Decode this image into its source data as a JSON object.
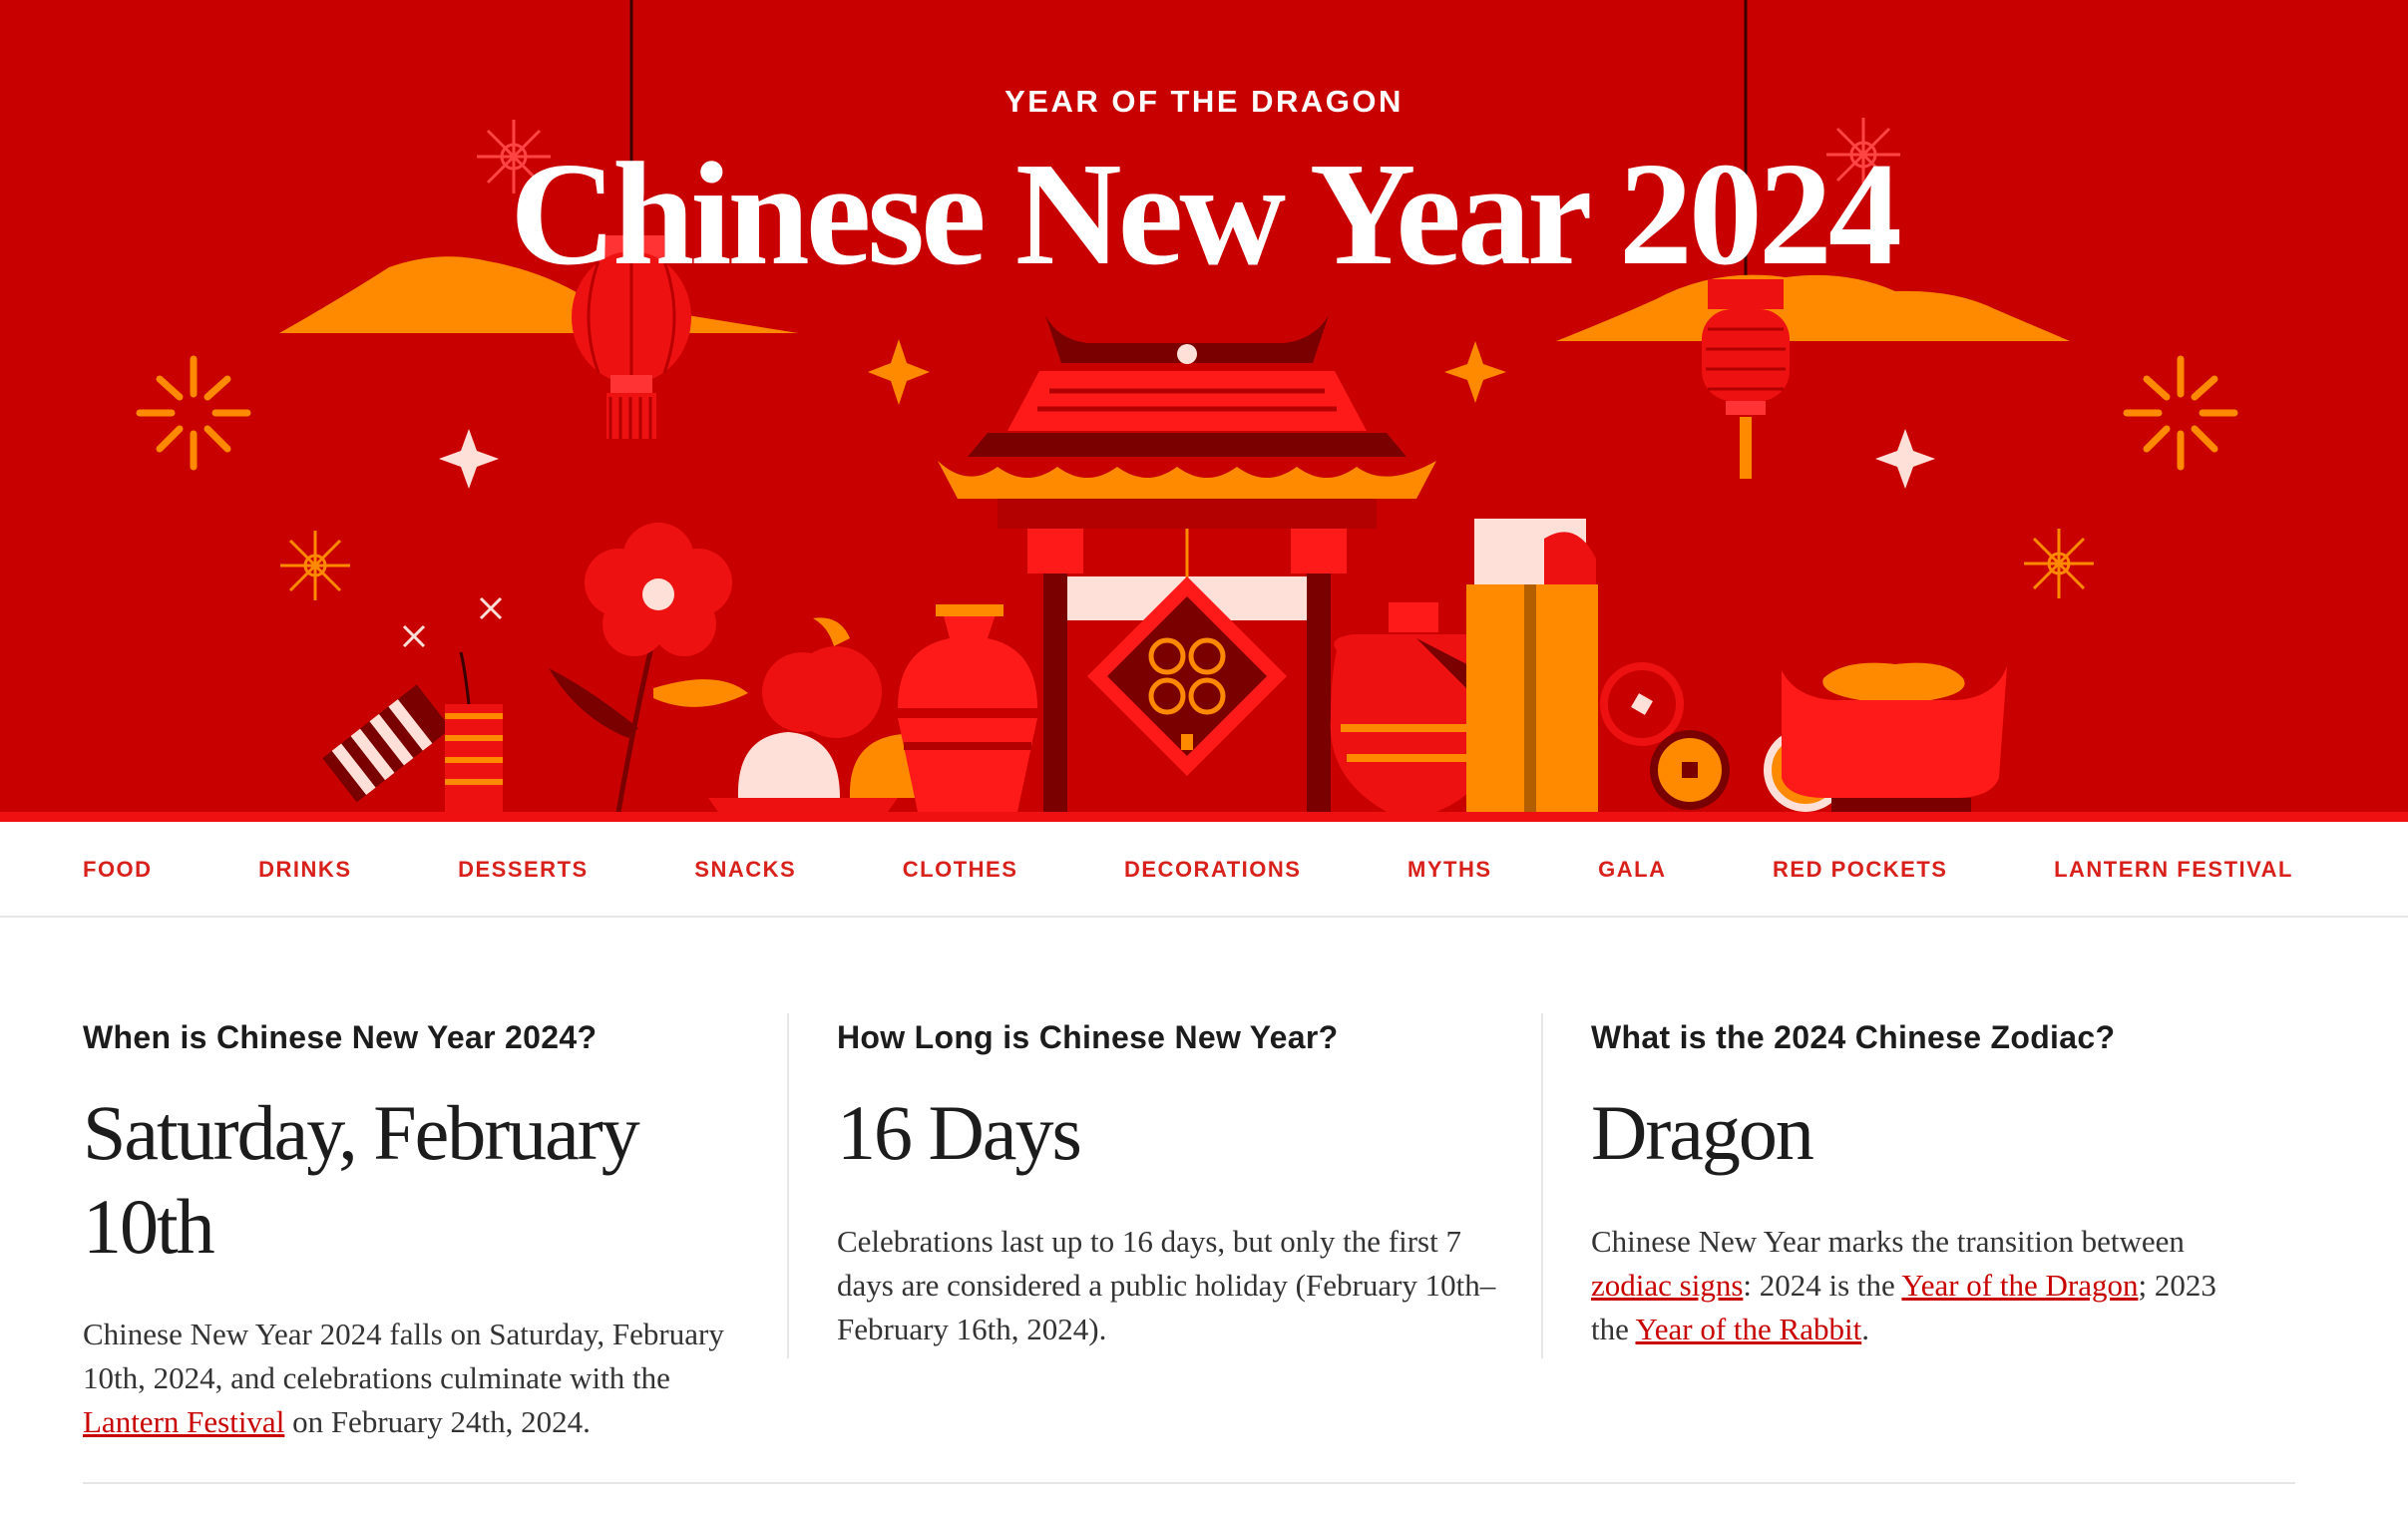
{
  "colors": {
    "hero_bg": "#c80000",
    "accent": "#d9211c",
    "orange": "#ff8a00",
    "dark": "#7a0000"
  },
  "hero": {
    "kicker": "YEAR OF THE DRAGON",
    "title": "Chinese New Year 2024"
  },
  "nav": {
    "items": [
      {
        "label": "FOOD"
      },
      {
        "label": "DRINKS"
      },
      {
        "label": "DESSERTS"
      },
      {
        "label": "SNACKS"
      },
      {
        "label": "CLOTHES"
      },
      {
        "label": "DECORATIONS"
      },
      {
        "label": "MYTHS"
      },
      {
        "label": "GALA"
      },
      {
        "label": "RED POCKETS"
      },
      {
        "label": "LANTERN FESTIVAL"
      }
    ]
  },
  "facts": {
    "when": {
      "question": "When is Chinese New Year 2024?",
      "answer": "Saturday, February 10th",
      "text_1": "Chinese New Year 2024 falls on Saturday, February 10th, 2024, and celebrations culminate with the ",
      "link_1": "Lantern Festival",
      "text_2": " on February 24th, 2024."
    },
    "length": {
      "question": "How Long is Chinese New Year?",
      "answer": "16 Days",
      "text_1": "Celebrations last up to 16 days, but only the first 7 days are considered a public holiday (February 10th–February 16th, 2024)."
    },
    "zodiac": {
      "question": "What is the 2024 Chinese Zodiac?",
      "answer": "Dragon",
      "text_1": "Chinese New Year marks the transition between ",
      "link_1": "zodiac signs",
      "text_2": ": 2024 is the ",
      "link_2": "Year of the Dragon",
      "text_3": "; 2023 the ",
      "link_3": "Year of the Rabbit",
      "text_4": "."
    }
  }
}
